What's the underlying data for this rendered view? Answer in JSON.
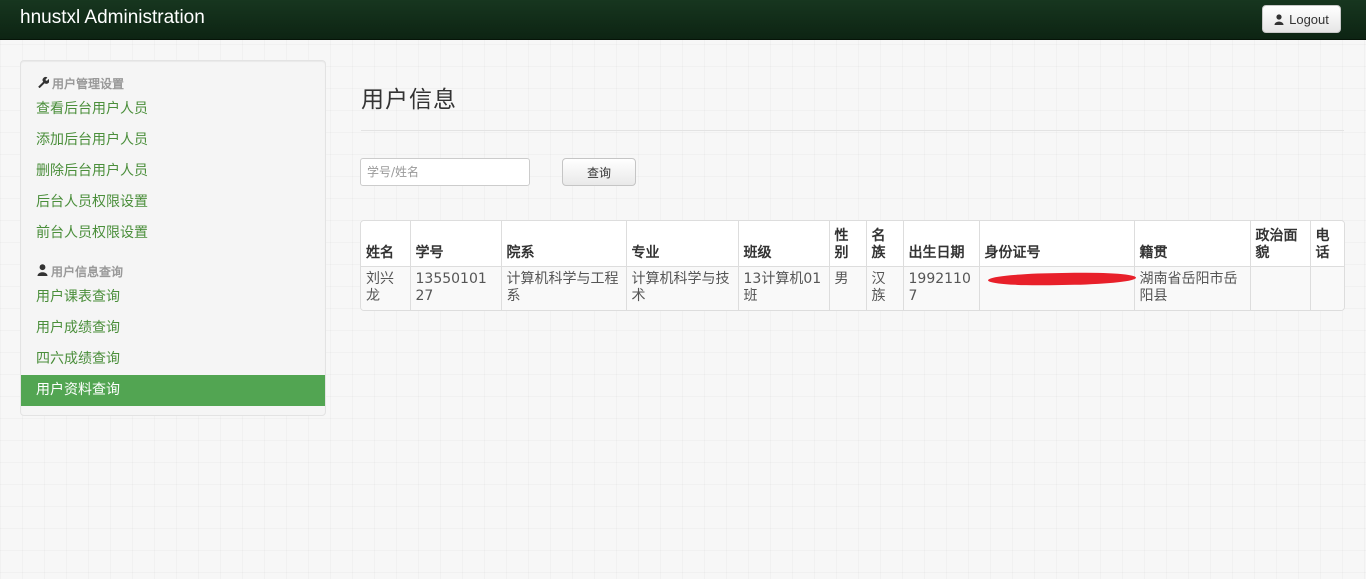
{
  "navbar": {
    "brand": "hnustxl Administration",
    "logout_label": "Logout"
  },
  "sidebar": {
    "groups": [
      {
        "header": "用户管理设置",
        "icon": "wrench-icon",
        "items": [
          {
            "label": "查看后台用户人员",
            "active": false
          },
          {
            "label": "添加后台用户人员",
            "active": false
          },
          {
            "label": "删除后台用户人员",
            "active": false
          },
          {
            "label": "后台人员权限设置",
            "active": false
          },
          {
            "label": "前台人员权限设置",
            "active": false
          }
        ]
      },
      {
        "header": "用户信息查询",
        "icon": "user-icon",
        "items": [
          {
            "label": "用户课表查询",
            "active": false
          },
          {
            "label": "用户成绩查询",
            "active": false
          },
          {
            "label": "四六成绩查询",
            "active": false
          },
          {
            "label": "用户资料查询",
            "active": true
          }
        ]
      }
    ]
  },
  "main": {
    "title": "用户信息",
    "search": {
      "placeholder": "学号/姓名",
      "value": "",
      "button_label": "查询"
    },
    "table": {
      "columns": [
        "姓名",
        "学号",
        "院系",
        "专业",
        "班级",
        "性别",
        "名族",
        "出生日期",
        "身份证号",
        "籍贯",
        "政治面貌",
        "电话"
      ],
      "rows": [
        [
          "刘兴龙",
          "1355010127",
          "计算机科学与工程系",
          "计算机科学与技术",
          "13计算机01班",
          "男",
          "汉族",
          "19921107",
          "",
          "湖南省岳阳市岳阳县",
          "",
          ""
        ]
      ]
    }
  },
  "colors": {
    "navbar": "#0d2413",
    "link": "#4a8e3a",
    "active": "#52a552",
    "redaction": "#e8202a"
  }
}
